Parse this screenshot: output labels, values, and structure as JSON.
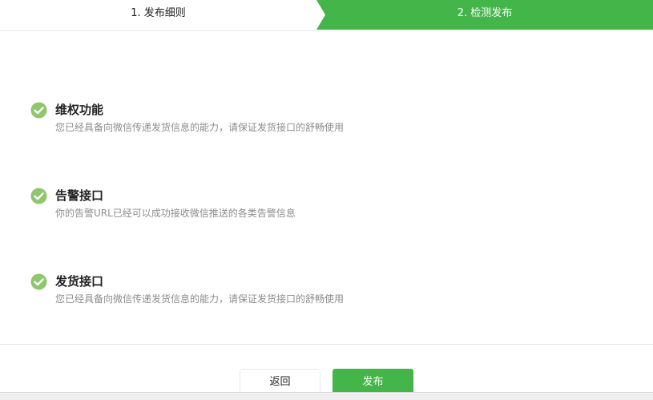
{
  "steps": [
    {
      "label": "1. 发布细则",
      "active": false
    },
    {
      "label": "2. 检测发布",
      "active": true
    }
  ],
  "checks": [
    {
      "title": "维权功能",
      "desc": "您已经具备向微信传递发货信息的能力，请保证发货接口的舒畅使用",
      "status_icon": "check-circle-icon"
    },
    {
      "title": "告警接口",
      "desc": "你的告警URL已经可以成功接收微信推送的各类告警信息",
      "status_icon": "check-circle-icon"
    },
    {
      "title": "发货接口",
      "desc": "您已经具备向微信传递发货信息的能力，请保证发货接口的舒畅使用",
      "status_icon": "check-circle-icon"
    }
  ],
  "actions": {
    "back_label": "返回",
    "publish_label": "发布"
  },
  "colors": {
    "accent": "#44b549",
    "check": "#8fc66e"
  }
}
